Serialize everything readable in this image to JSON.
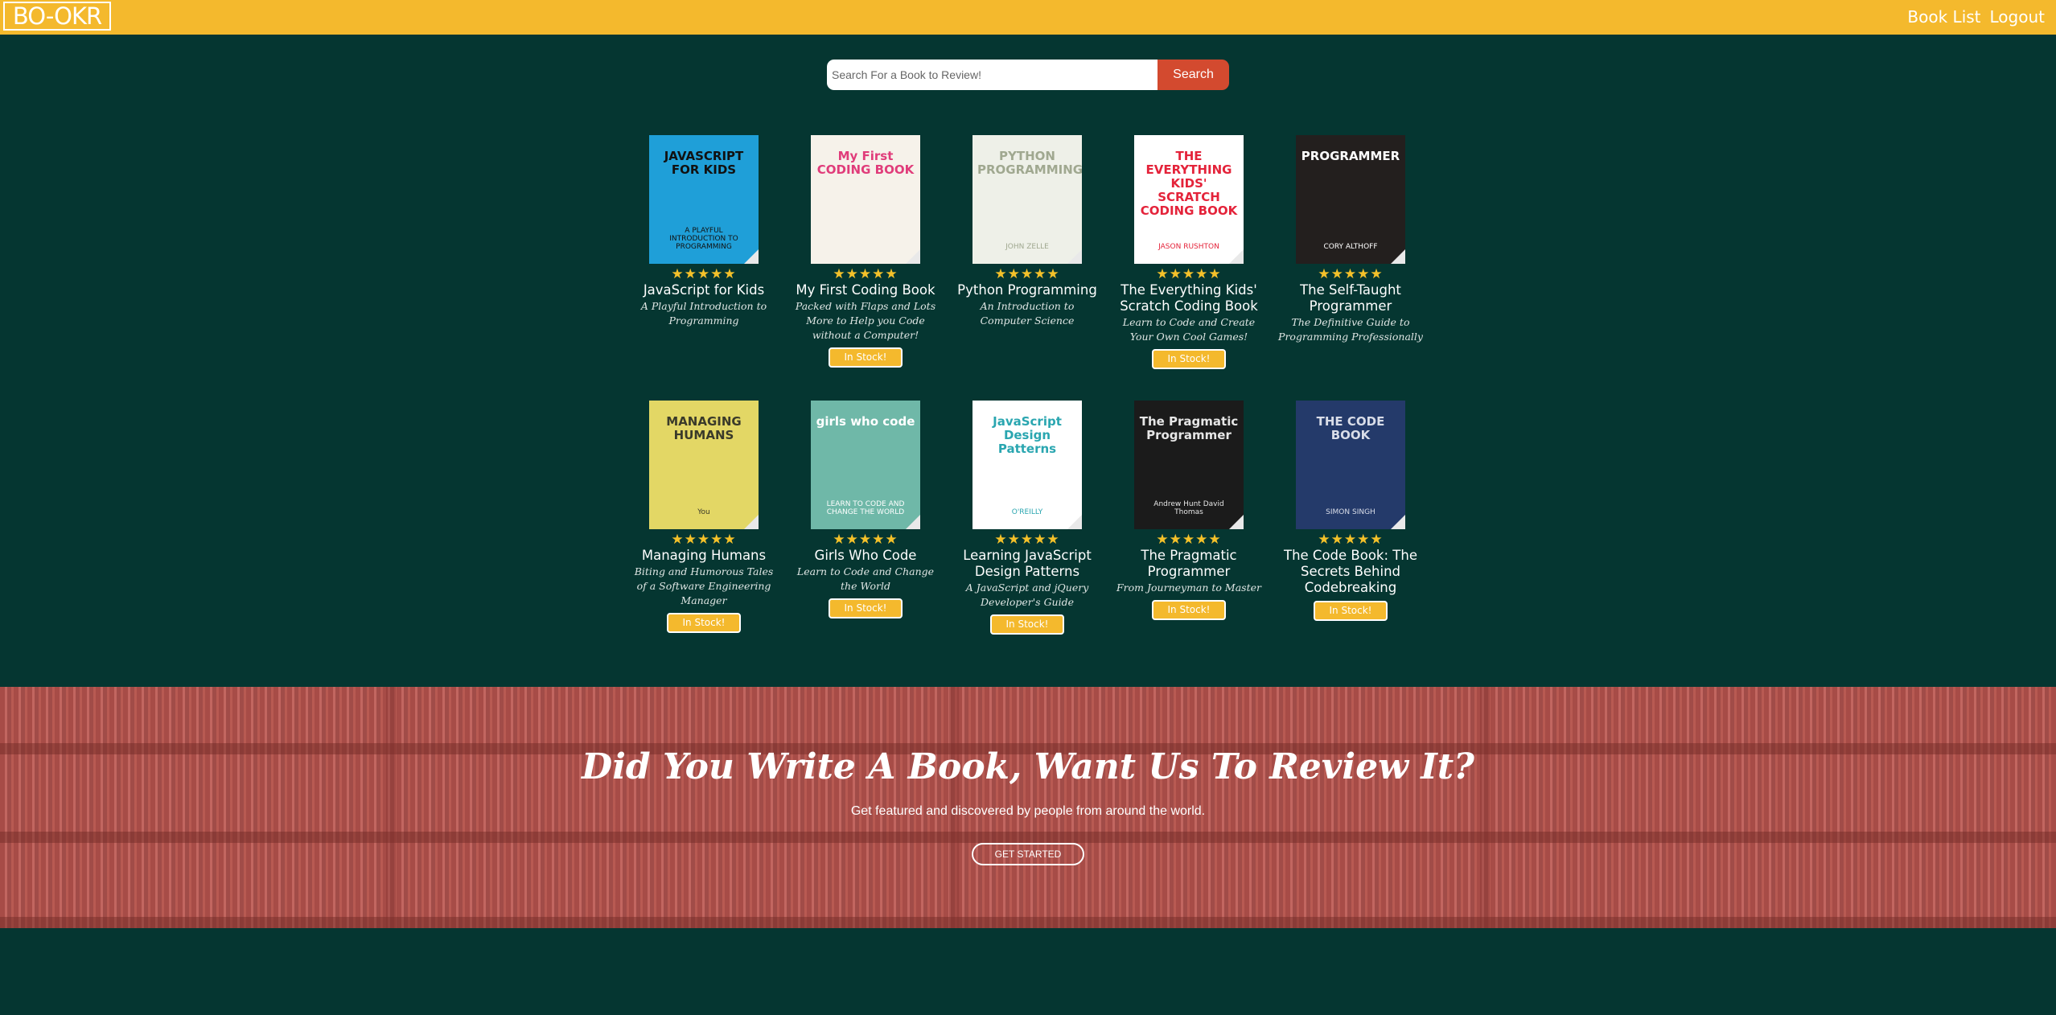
{
  "header": {
    "logo": "BO-OKR",
    "nav": [
      "Book List",
      "Logout"
    ]
  },
  "search": {
    "placeholder": "Search For a Book to Review!",
    "button": "Search"
  },
  "books": [
    {
      "title": "JavaScript for Kids",
      "subtitle": "A Playful Introduction to Programming",
      "stars": "★★★★★",
      "stock": "",
      "cover_text": "JAVASCRIPT FOR KIDS",
      "cover_sub": "A PLAYFUL INTRODUCTION TO PROGRAMMING",
      "cover_color": "#1f9fd8",
      "cover_fg": "#111111"
    },
    {
      "title": "My First Coding Book",
      "subtitle": "Packed with Flaps and Lots More to Help you Code without a Computer!",
      "stars": "★★★★★",
      "stock": "In Stock!",
      "cover_text": "My First CODING BOOK",
      "cover_sub": "",
      "cover_color": "#f6f2ea",
      "cover_fg": "#e03c7a"
    },
    {
      "title": "Python Programming",
      "subtitle": "An Introduction to Computer Science",
      "stars": "★★★★★",
      "stock": "",
      "cover_text": "PYTHON PROGRAMMING",
      "cover_sub": "JOHN ZELLE",
      "cover_color": "#eef0e8",
      "cover_fg": "#a0a890"
    },
    {
      "title": "The Everything Kids' Scratch Coding Book",
      "subtitle": "Learn to Code and Create Your Own Cool Games!",
      "stars": "★★★★★",
      "stock": "In Stock!",
      "cover_text": "THE EVERYTHING KIDS' SCRATCH CODING BOOK",
      "cover_sub": "JASON RUSHTON",
      "cover_color": "#ffffff",
      "cover_fg": "#e4233a"
    },
    {
      "title": "The Self-Taught Programmer",
      "subtitle": "The Definitive Guide to Programming Professionally",
      "stars": "★★★★★",
      "stock": "",
      "cover_text": "PROGRAMMER",
      "cover_sub": "CORY ALTHOFF",
      "cover_color": "#231f1e",
      "cover_fg": "#ffffff"
    },
    {
      "title": "Managing Humans",
      "subtitle": "Biting and Humorous Tales of a Software Engineering Manager",
      "stars": "★★★★★",
      "stock": "In Stock!",
      "cover_text": "MANAGING HUMANS",
      "cover_sub": "You",
      "cover_color": "#e3d765",
      "cover_fg": "#3a3a2a"
    },
    {
      "title": "Girls Who Code",
      "subtitle": "Learn to Code and Change the World",
      "stars": "★★★★★",
      "stock": "In Stock!",
      "cover_text": "girls who code",
      "cover_sub": "LEARN TO CODE AND CHANGE THE WORLD",
      "cover_color": "#6fb8a8",
      "cover_fg": "#ffffff"
    },
    {
      "title": "Learning JavaScript Design Patterns",
      "subtitle": "A JavaScript and jQuery Developer's Guide",
      "stars": "★★★★★",
      "stock": "In Stock!",
      "cover_text": "JavaScript Design Patterns",
      "cover_sub": "O'REILLY",
      "cover_color": "#ffffff",
      "cover_fg": "#2aa6b0"
    },
    {
      "title": "The Pragmatic Programmer",
      "subtitle": "From Journeyman to Master",
      "stars": "★★★★★",
      "stock": "In Stock!",
      "cover_text": "The Pragmatic Programmer",
      "cover_sub": "Andrew Hunt David Thomas",
      "cover_color": "#1b1b1b",
      "cover_fg": "#e6e6e6"
    },
    {
      "title": "The Code Book: The Secrets Behind Codebreaking",
      "subtitle": "",
      "stars": "★★★★★",
      "stock": "In Stock!",
      "cover_text": "THE CODE BOOK",
      "cover_sub": "SIMON SINGH",
      "cover_color": "#243a6a",
      "cover_fg": "#d9dde8"
    }
  ],
  "banner": {
    "title": "Did You Write A Book, Want Us To Review It?",
    "subtitle": "Get featured and discovered by people from around the world.",
    "button": "GET STARTED"
  }
}
